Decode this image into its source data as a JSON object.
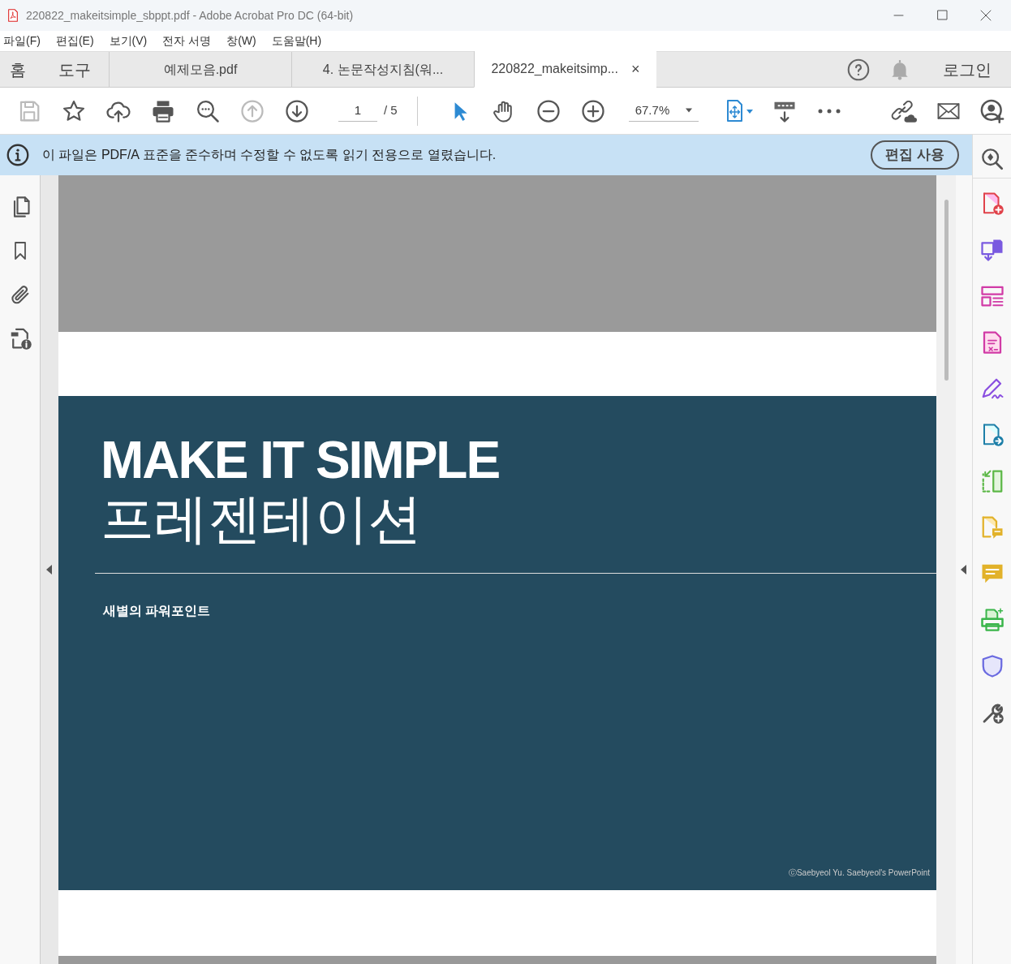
{
  "window": {
    "title": "220822_makeitsimple_sbppt.pdf - Adobe Acrobat Pro DC (64-bit)"
  },
  "menu": [
    "파일(F)",
    "편집(E)",
    "보기(V)",
    "전자 서명",
    "창(W)",
    "도움말(H)"
  ],
  "nav_tabs": [
    {
      "label": "홈"
    },
    {
      "label": "도구"
    }
  ],
  "doc_tabs": [
    {
      "label": "예제모음.pdf",
      "selected": false
    },
    {
      "label": "4. 논문작성지침(워...",
      "selected": false
    },
    {
      "label": "220822_makeitsimp...",
      "selected": true,
      "close": "×"
    }
  ],
  "login": "로그인",
  "toolbar": [
    {
      "kind": "save",
      "disabled": true
    },
    {
      "kind": "star",
      "disabled": false
    },
    {
      "kind": "upload",
      "disabled": false
    },
    {
      "kind": "print",
      "disabled": false
    },
    {
      "kind": "search",
      "disabled": false
    },
    {
      "kind": "up",
      "disabled": true
    },
    {
      "kind": "down",
      "disabled": false
    }
  ],
  "page": {
    "current": "1",
    "total": "/ 5"
  },
  "zoom": "67.7%",
  "notice": {
    "text": "이 파일은 PDF/A 표준을 준수하며 수정할 수 없도록 읽기 전용으로 열렸습니다.",
    "button": "편집 사용"
  },
  "slide": {
    "title": "MAKE IT SIMPLE",
    "subtitle": "프레젠테이션",
    "author": "새별의 파워포인트",
    "copyright": "ⓒSaebyeol Yu. Saebyeol's PowerPoint"
  }
}
